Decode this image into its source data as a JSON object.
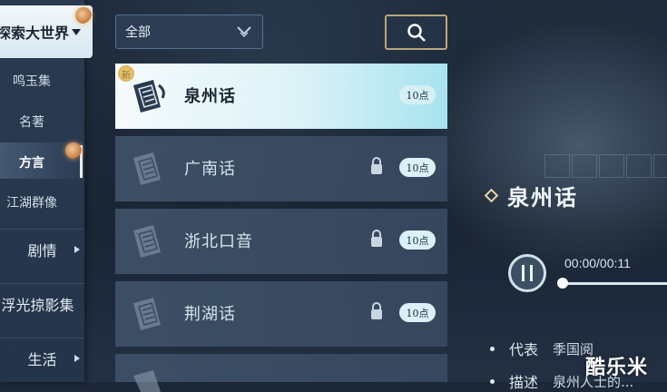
{
  "nav": {
    "header": "探索大世界",
    "subitems": [
      "鸣玉集",
      "名著",
      "方言",
      "江湖群像"
    ],
    "active_subitem": "方言",
    "categories": [
      "剧情",
      "浮光掠影集",
      "生活"
    ]
  },
  "filter": {
    "value": "全部"
  },
  "list": {
    "items": [
      {
        "title": "泉州话",
        "badge": "10点",
        "selected": true,
        "locked": false,
        "new_tag": "新"
      },
      {
        "title": "广南话",
        "badge": "10点",
        "selected": false,
        "locked": true
      },
      {
        "title": "浙北口音",
        "badge": "10点",
        "selected": false,
        "locked": true
      },
      {
        "title": "荆湖话",
        "badge": "10点",
        "selected": false,
        "locked": true
      }
    ]
  },
  "detail": {
    "title": "泉州话",
    "time": "00:00/00:11",
    "progress": 0,
    "representative_label": "代表",
    "representative_value": "季国阅",
    "description_label": "描述",
    "description_value": "泉州人士的..."
  },
  "watermark": "酷乐米",
  "colors": {
    "accent": "#b9a77c",
    "selected_bg": "#dcf2f7",
    "badge_bg": "#d9f1f7"
  }
}
